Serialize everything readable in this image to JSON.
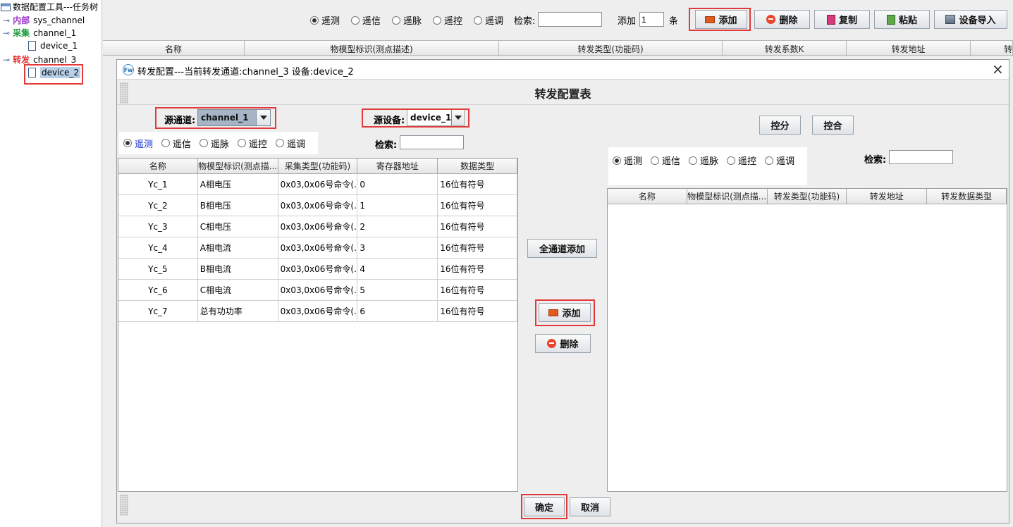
{
  "tree": {
    "root": "数据配置工具---任务树",
    "internal": {
      "category": "内部",
      "channel": "sys_channel"
    },
    "collect": {
      "category": "采集",
      "channel": "channel_1",
      "device": "device_1"
    },
    "forward": {
      "category": "转发",
      "channel": "channel_3",
      "device": "device_2"
    }
  },
  "toolbar": {
    "radios": [
      "遥测",
      "遥信",
      "遥脉",
      "遥控",
      "遥调"
    ],
    "selected_radio": "遥测",
    "search_label": "检索:",
    "search_value": "",
    "add_prefix": "添加",
    "add_count": "1",
    "add_suffix": "条",
    "buttons": {
      "add": "添加",
      "delete": "删除",
      "copy": "复制",
      "paste": "粘贴",
      "import": "设备导入"
    }
  },
  "main_table": {
    "headers": [
      "名称",
      "物模型标识(测点描述)",
      "转发类型(功能码)",
      "转发系数K",
      "转发地址",
      "转"
    ]
  },
  "dialog": {
    "title": "转发配置---当前转发通道:channel_3  设备:device_2",
    "app_badge": "Fw",
    "heading": "转发配置表",
    "source_channel_label": "源通道:",
    "source_channel_value": "channel_1",
    "source_device_label": "源设备:",
    "source_device_value": "device_1",
    "left_radios": [
      "遥测",
      "遥信",
      "遥脉",
      "遥控",
      "遥调"
    ],
    "left_search_label": "检索:",
    "left_search_value": "",
    "left_table": {
      "headers": [
        "名称",
        "物模型标识(测点描...",
        "采集类型(功能码)",
        "寄存器地址",
        "数据类型"
      ],
      "rows": [
        [
          "Yc_1",
          "A相电压",
          "0x03,0x06号命令(...",
          "0",
          "16位有符号"
        ],
        [
          "Yc_2",
          "B相电压",
          "0x03,0x06号命令(...",
          "1",
          "16位有符号"
        ],
        [
          "Yc_3",
          "C相电压",
          "0x03,0x06号命令(...",
          "2",
          "16位有符号"
        ],
        [
          "Yc_4",
          "A相电流",
          "0x03,0x06号命令(...",
          "3",
          "16位有符号"
        ],
        [
          "Yc_5",
          "B相电流",
          "0x03,0x06号命令(...",
          "4",
          "16位有符号"
        ],
        [
          "Yc_6",
          "C相电流",
          "0x03,0x06号命令(...",
          "5",
          "16位有符号"
        ],
        [
          "Yc_7",
          "总有功功率",
          "0x03,0x06号命令(...",
          "6",
          "16位有符号"
        ]
      ]
    },
    "mid_buttons": {
      "add_all": "全通道添加",
      "add": "添加",
      "delete": "删除"
    },
    "right_buttons": {
      "split": "控分",
      "close": "控合"
    },
    "right_radios": [
      "遥测",
      "遥信",
      "遥脉",
      "遥控",
      "遥调"
    ],
    "right_search_label": "检索:",
    "right_search_value": "",
    "right_table": {
      "headers": [
        "名称",
        "物模型标识(测点描...",
        "转发类型(功能码)",
        "转发地址",
        "转发数据类型"
      ]
    },
    "footer": {
      "ok": "确定",
      "cancel": "取消"
    }
  },
  "colors": {
    "highlight_box": "#e23a3a",
    "combo_selected": "#a5b5c5",
    "internal": "#9b30c8",
    "collect": "#1a9a3a",
    "forward": "#e03030"
  }
}
